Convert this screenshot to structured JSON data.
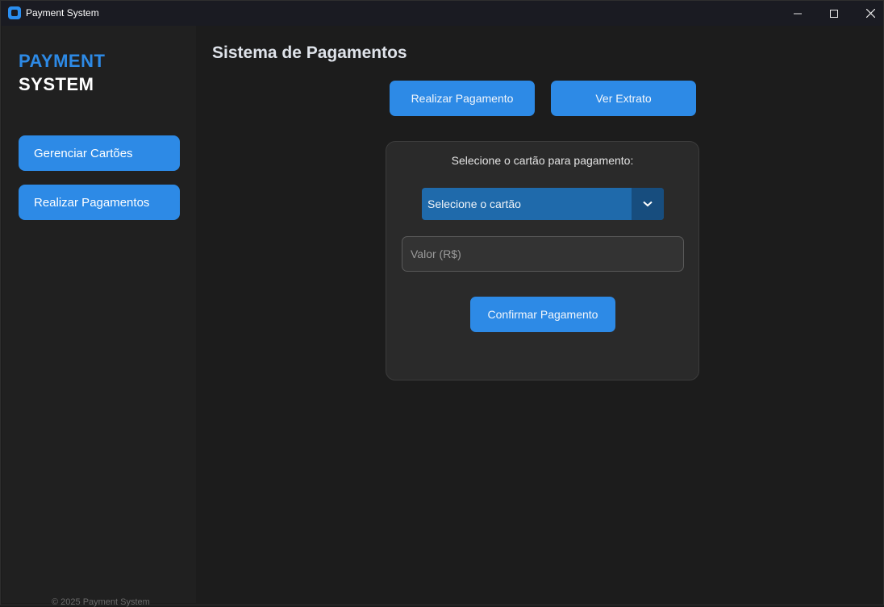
{
  "window": {
    "title": "Payment System",
    "controls": {
      "minimize_icon": "minimize-icon",
      "maximize_icon": "maximize-icon",
      "close_icon": "close-icon"
    }
  },
  "sidebar": {
    "logo_line1": "PAYMENT",
    "logo_line2": "SYSTEM",
    "items": [
      {
        "label": "Gerenciar Cartões"
      },
      {
        "label": "Realizar Pagamentos"
      }
    ],
    "footer": "© 2025 Payment System"
  },
  "main": {
    "title": "Sistema de Pagamentos",
    "tabs": [
      {
        "label": "Realizar Pagamento"
      },
      {
        "label": "Ver Extrato"
      }
    ],
    "form": {
      "card_label": "Selecione o cartão para pagamento:",
      "card_select_value": "Selecione o cartão",
      "amount_placeholder": "Valor (R$)",
      "amount_value": "",
      "confirm_label": "Confirmar Pagamento"
    }
  },
  "colors": {
    "accent": "#2d8ae6",
    "select_bg": "#1f6aab",
    "select_arrow_bg": "#174d7e",
    "sidebar_bg": "#202020",
    "main_bg": "#1c1c1c",
    "card_bg": "#2a2a2a"
  }
}
